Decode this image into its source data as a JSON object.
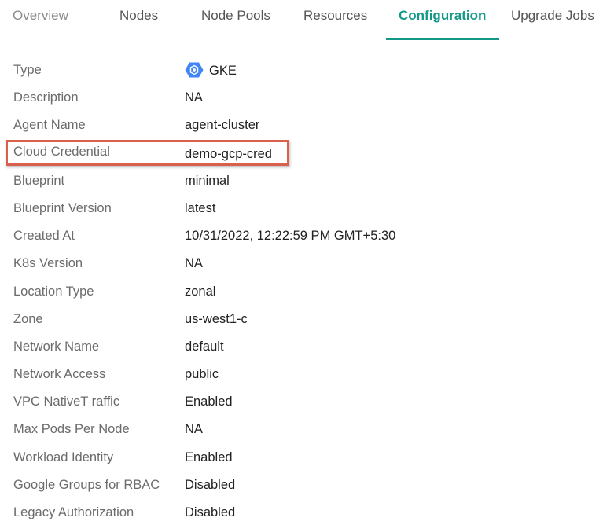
{
  "tabs": [
    {
      "label": "Overview"
    },
    {
      "label": "Nodes"
    },
    {
      "label": "Node Pools"
    },
    {
      "label": "Resources"
    },
    {
      "label": "Configuration"
    },
    {
      "label": "Upgrade Jobs"
    }
  ],
  "active_tab": "Configuration",
  "accent_color": "#139887",
  "highlight_color": "#d9604c",
  "rows": [
    {
      "label": "Type",
      "value": "GKE",
      "icon": "gke-hexagon-icon"
    },
    {
      "label": "Description",
      "value": "NA"
    },
    {
      "label": "Agent Name",
      "value": "agent-cluster"
    },
    {
      "label": "Cloud Credential",
      "value": "demo-gcp-cred",
      "highlighted": true
    },
    {
      "label": "Blueprint",
      "value": "minimal"
    },
    {
      "label": "Blueprint Version",
      "value": "latest"
    },
    {
      "label": "Created At",
      "value": "10/31/2022, 12:22:59 PM GMT+5:30"
    },
    {
      "label": "K8s Version",
      "value": "NA"
    },
    {
      "label": "Location Type",
      "value": "zonal"
    },
    {
      "label": "Zone",
      "value": "us-west1-c"
    },
    {
      "label": "Network Name",
      "value": "default"
    },
    {
      "label": "Network Access",
      "value": "public"
    },
    {
      "label": "VPC NativeT raffic",
      "value": "Enabled"
    },
    {
      "label": "Max Pods Per Node",
      "value": "NA"
    },
    {
      "label": "Workload Identity",
      "value": "Enabled"
    },
    {
      "label": "Google Groups for RBAC",
      "value": "Disabled"
    },
    {
      "label": "Legacy Authorization",
      "value": "Disabled"
    }
  ]
}
